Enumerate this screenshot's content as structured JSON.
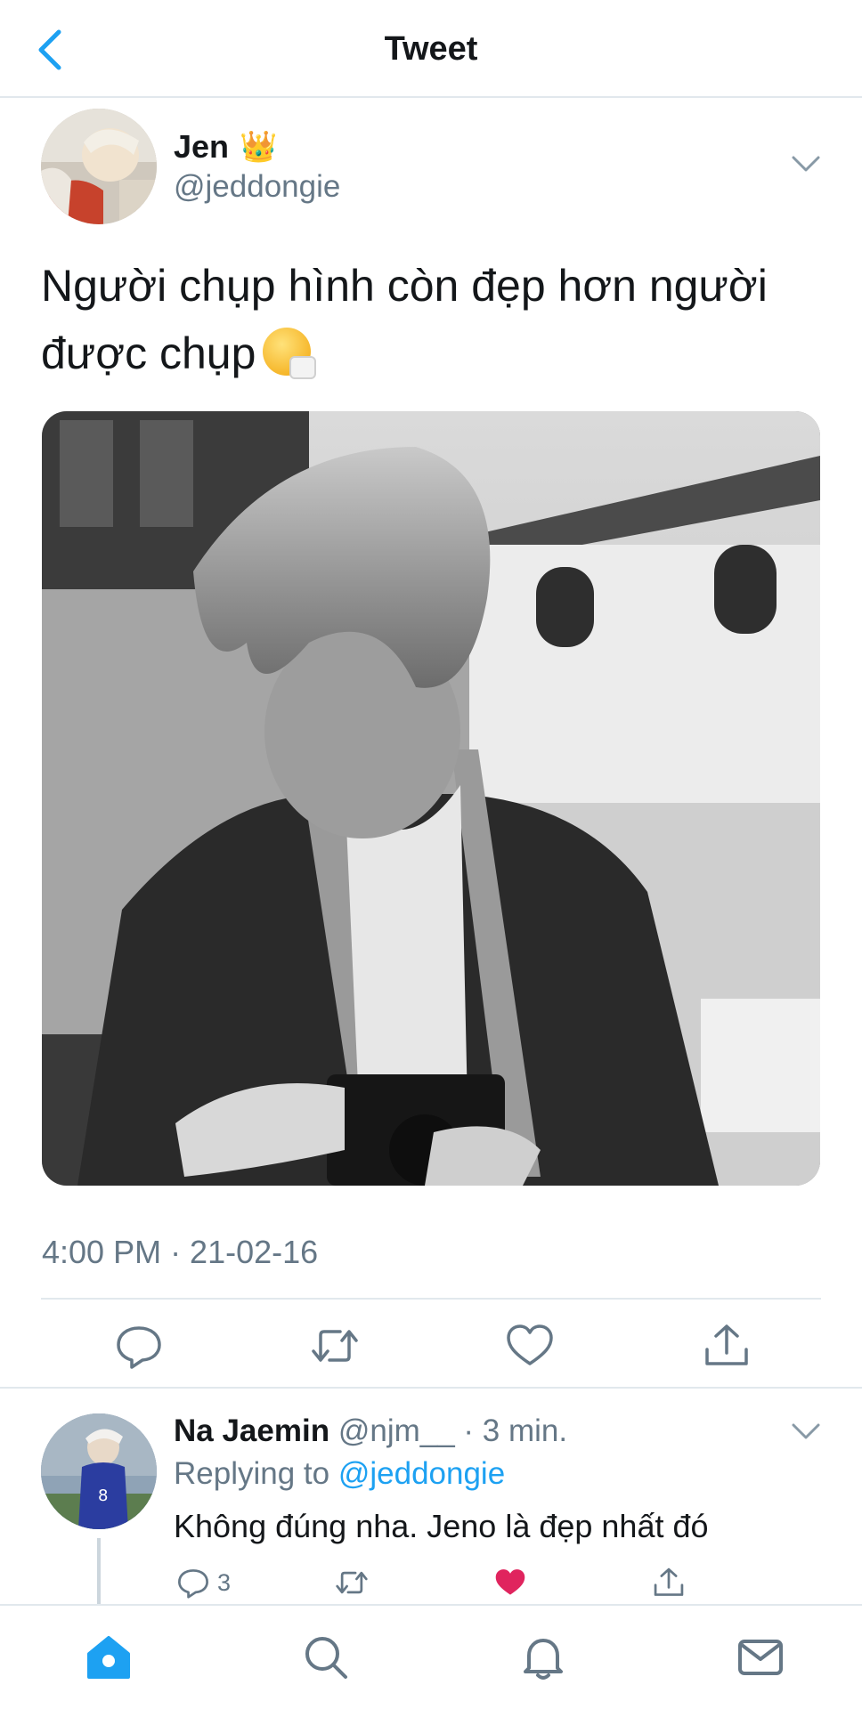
{
  "nav": {
    "title": "Tweet",
    "back_icon": "chevron-left-icon"
  },
  "tweet": {
    "author_name": "Jen",
    "author_badge_emoji": "👑",
    "author_handle": "@jeddongie",
    "text": "Người chụp hình còn đẹp hơn người được chụp",
    "text_emoji": "sneezing-face-emoji",
    "timestamp": "4:00 PM · 21-02-16",
    "actions": [
      "reply-icon",
      "retweet-icon",
      "like-icon",
      "share-icon"
    ]
  },
  "reply": {
    "author_name": "Na Jaemin",
    "author_handle": "@njm__",
    "separator": " · ",
    "time": "3 min.",
    "replying_prefix": "Replying to ",
    "replying_to": "@jeddongie",
    "text": "Không đúng nha. Jeno là đẹp nhất đó",
    "reply_count": "3",
    "liked": true
  },
  "tabs": [
    "home-icon",
    "search-icon",
    "notifications-icon",
    "messages-icon"
  ],
  "colors": {
    "accent": "#1da1f2",
    "like": "#e0245e",
    "muted": "#657786",
    "text": "#14171a",
    "border": "#e1e8ed"
  }
}
